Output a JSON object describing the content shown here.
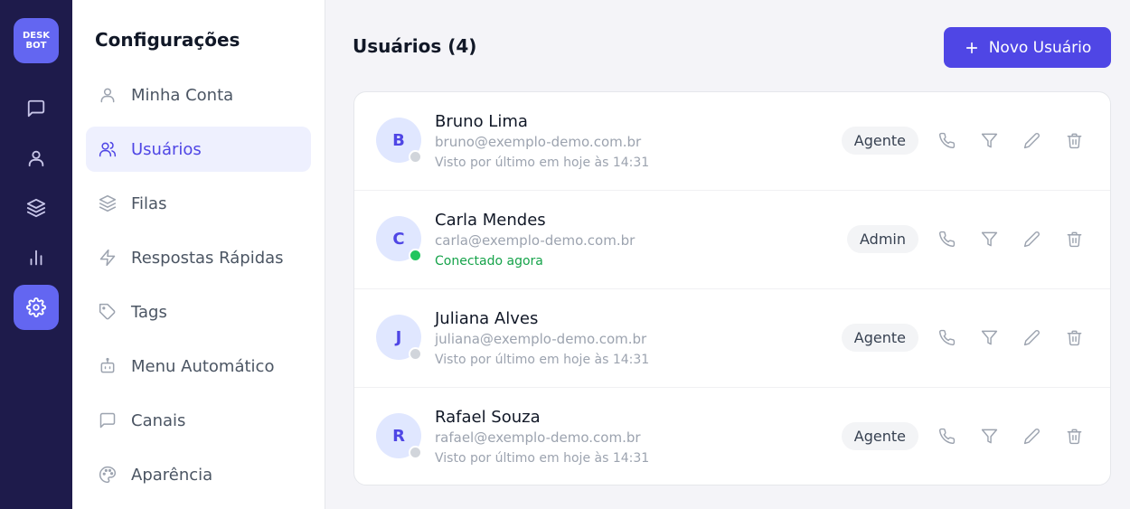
{
  "app": {
    "logo_line1": "DESK",
    "logo_line2": "BOT"
  },
  "rail": {
    "items": [
      {
        "icon": "chat-icon",
        "active": false
      },
      {
        "icon": "user-icon",
        "active": false
      },
      {
        "icon": "layers-icon",
        "active": false
      },
      {
        "icon": "bar-chart-icon",
        "active": false
      },
      {
        "icon": "gear-icon",
        "active": true
      }
    ]
  },
  "settings_nav": {
    "title": "Configurações",
    "items": [
      {
        "label": "Minha Conta",
        "icon": "user-icon",
        "active": false
      },
      {
        "label": "Usuários",
        "icon": "users-icon",
        "active": true
      },
      {
        "label": "Filas",
        "icon": "layers-icon",
        "active": false
      },
      {
        "label": "Respostas Rápidas",
        "icon": "lightning-icon",
        "active": false
      },
      {
        "label": "Tags",
        "icon": "tag-icon",
        "active": false
      },
      {
        "label": "Menu Automático",
        "icon": "robot-icon",
        "active": false
      },
      {
        "label": "Canais",
        "icon": "message-square-icon",
        "active": false
      },
      {
        "label": "Aparência",
        "icon": "palette-icon",
        "active": false
      }
    ]
  },
  "main": {
    "title": "Usuários (4)",
    "new_button_label": "Novo Usuário",
    "users": [
      {
        "initial": "B",
        "name": "Bruno Lima",
        "email": "bruno@exemplo-demo.com.br",
        "last_seen": "Visto por último em hoje às 14:31",
        "online": false,
        "role": "Agente"
      },
      {
        "initial": "C",
        "name": "Carla Mendes",
        "email": "carla@exemplo-demo.com.br",
        "last_seen": "Conectado agora",
        "online": true,
        "role": "Admin"
      },
      {
        "initial": "J",
        "name": "Juliana Alves",
        "email": "juliana@exemplo-demo.com.br",
        "last_seen": "Visto por último em hoje às 14:31",
        "online": false,
        "role": "Agente"
      },
      {
        "initial": "R",
        "name": "Rafael Souza",
        "email": "rafael@exemplo-demo.com.br",
        "last_seen": "Visto por último em hoje às 14:31",
        "online": false,
        "role": "Agente"
      }
    ]
  },
  "colors": {
    "rail_bg": "#1e1b4b",
    "accent": "#4f46e5",
    "online": "#22c55e"
  }
}
